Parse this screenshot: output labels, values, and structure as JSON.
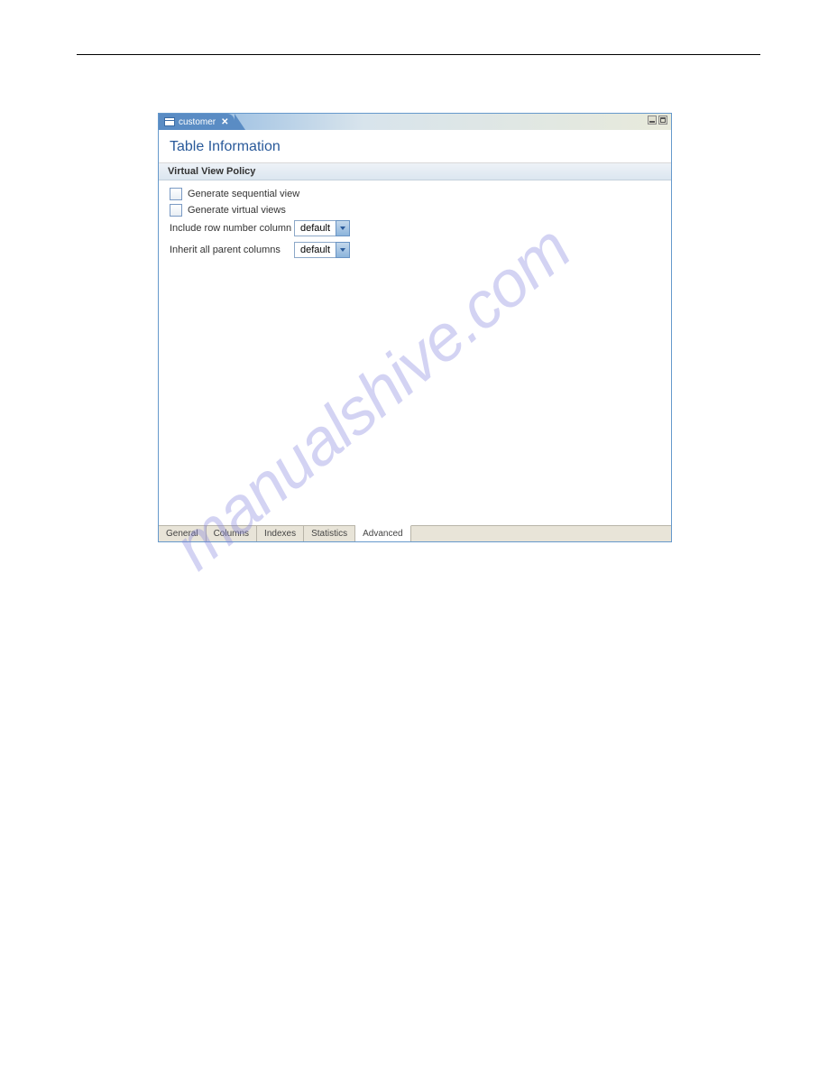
{
  "window": {
    "tab_name": "customer",
    "title": "Table Information"
  },
  "section": {
    "header": "Virtual View Policy"
  },
  "checkboxes": [
    {
      "label": "Generate sequential view"
    },
    {
      "label": "Generate virtual views"
    }
  ],
  "dropdowns": [
    {
      "label": "Include row number column",
      "value": "default"
    },
    {
      "label": "Inherit all parent columns",
      "value": "default"
    }
  ],
  "tabs": [
    {
      "label": "General"
    },
    {
      "label": "Columns"
    },
    {
      "label": "Indexes"
    },
    {
      "label": "Statistics"
    },
    {
      "label": "Advanced"
    }
  ],
  "watermark": "manualshive.com"
}
